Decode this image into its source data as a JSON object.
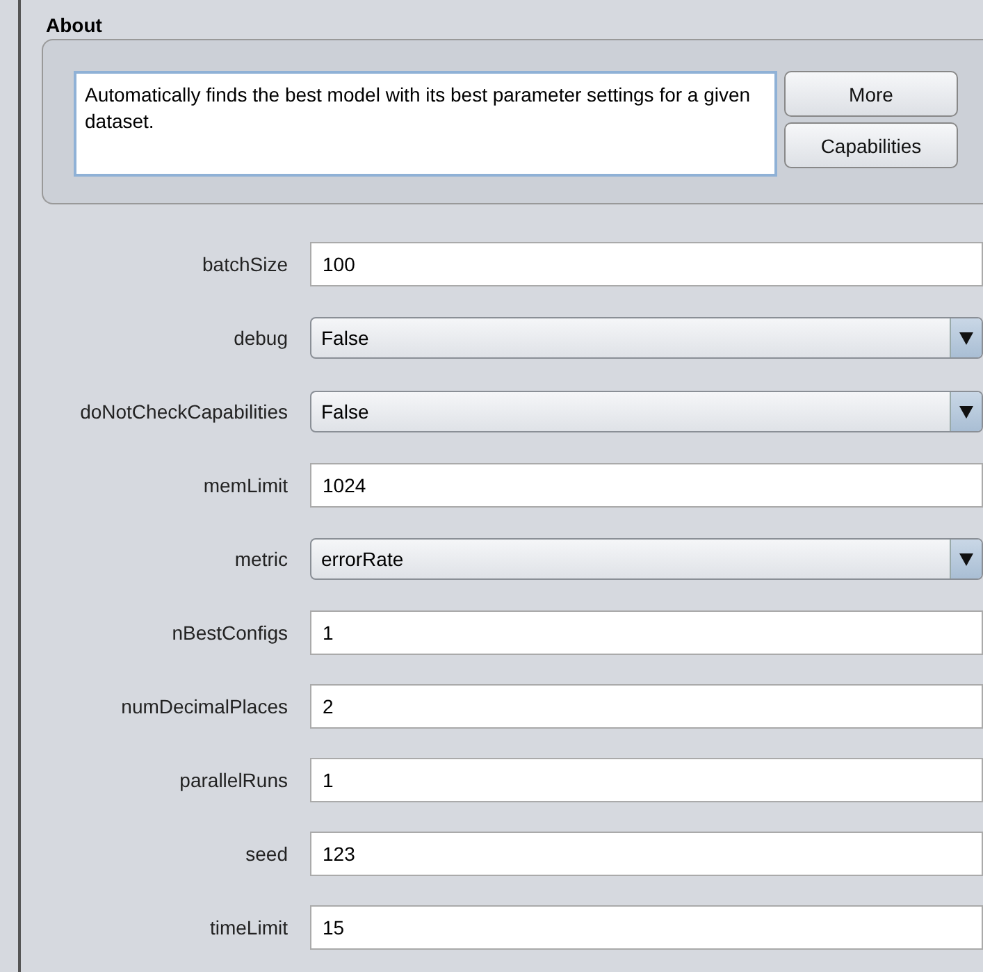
{
  "about": {
    "title": "About",
    "description": "Automatically finds the best model with its best parameter settings for a given dataset.",
    "buttons": [
      "More",
      "Capabilities"
    ]
  },
  "params": [
    {
      "label": "batchSize",
      "kind": "text",
      "value": "100"
    },
    {
      "label": "debug",
      "kind": "dropdown",
      "value": "False"
    },
    {
      "label": "doNotCheckCapabilities",
      "kind": "dropdown",
      "value": "False"
    },
    {
      "label": "memLimit",
      "kind": "text",
      "value": "1024"
    },
    {
      "label": "metric",
      "kind": "dropdown",
      "value": "errorRate"
    },
    {
      "label": "nBestConfigs",
      "kind": "text",
      "value": "1"
    },
    {
      "label": "numDecimalPlaces",
      "kind": "text",
      "value": "2"
    },
    {
      "label": "parallelRuns",
      "kind": "text",
      "value": "1"
    },
    {
      "label": "seed",
      "kind": "text",
      "value": "123"
    },
    {
      "label": "timeLimit",
      "kind": "text",
      "value": "15"
    }
  ]
}
